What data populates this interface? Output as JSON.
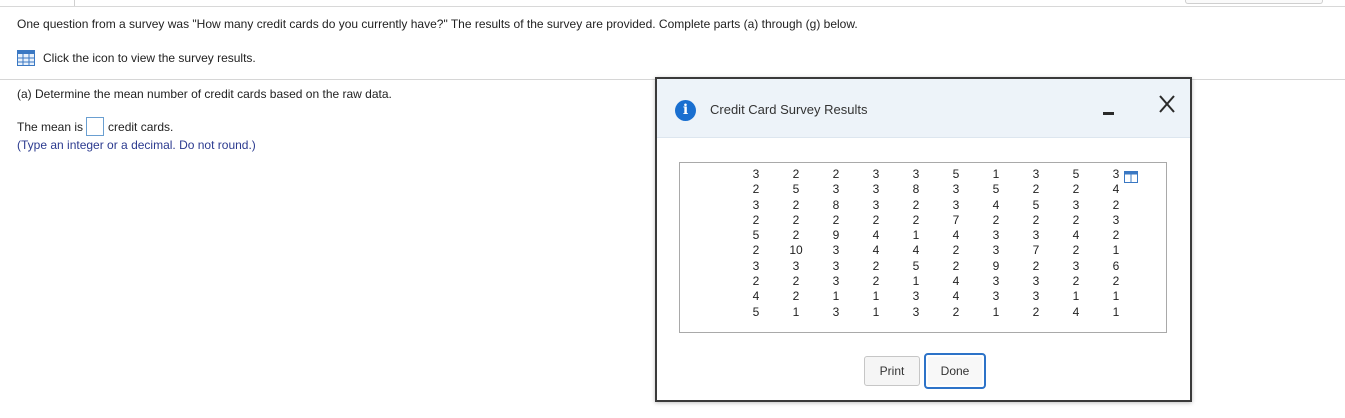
{
  "question": {
    "text": "One question from a survey was \"How many credit cards do you currently have?\" The results of the survey are provided. Complete parts (a) through (g) below.",
    "view_link": "Click the icon to view the survey results."
  },
  "part_a": {
    "prompt": "(a) Determine the mean number of credit cards based on the raw data.",
    "answer_prefix": "The mean is",
    "answer_value": "",
    "answer_suffix": "credit cards.",
    "hint": "(Type an integer or a decimal. Do not round.)"
  },
  "modal": {
    "title": "Credit Card Survey Results",
    "table_rows": [
      [
        "3",
        "2",
        "2",
        "3",
        "3",
        "5",
        "1",
        "3",
        "5",
        "3"
      ],
      [
        "2",
        "5",
        "3",
        "3",
        "8",
        "3",
        "5",
        "2",
        "2",
        "4"
      ],
      [
        "3",
        "2",
        "8",
        "3",
        "2",
        "3",
        "4",
        "5",
        "3",
        "2"
      ],
      [
        "2",
        "2",
        "2",
        "2",
        "2",
        "7",
        "2",
        "2",
        "2",
        "3"
      ],
      [
        "5",
        "2",
        "9",
        "4",
        "1",
        "4",
        "3",
        "3",
        "4",
        "2"
      ],
      [
        "2",
        "10",
        "3",
        "4",
        "4",
        "2",
        "3",
        "7",
        "2",
        "1"
      ],
      [
        "3",
        "3",
        "3",
        "2",
        "5",
        "2",
        "9",
        "2",
        "3",
        "6"
      ],
      [
        "2",
        "2",
        "3",
        "2",
        "1",
        "4",
        "3",
        "3",
        "2",
        "2"
      ],
      [
        "4",
        "2",
        "1",
        "1",
        "3",
        "4",
        "3",
        "3",
        "1",
        "1"
      ],
      [
        "5",
        "1",
        "3",
        "1",
        "3",
        "2",
        "1",
        "2",
        "4",
        "1"
      ]
    ],
    "print_label": "Print",
    "done_label": "Done"
  },
  "icons": {
    "survey_grid": "grid-icon",
    "info": "info-icon",
    "minimize": "minimize-icon",
    "close": "close-icon",
    "copy": "copy-icon"
  },
  "colors": {
    "accent": "#1a6fd0",
    "hint_text": "#2b3a8f",
    "modal_header_bg": "#edf3f9"
  }
}
